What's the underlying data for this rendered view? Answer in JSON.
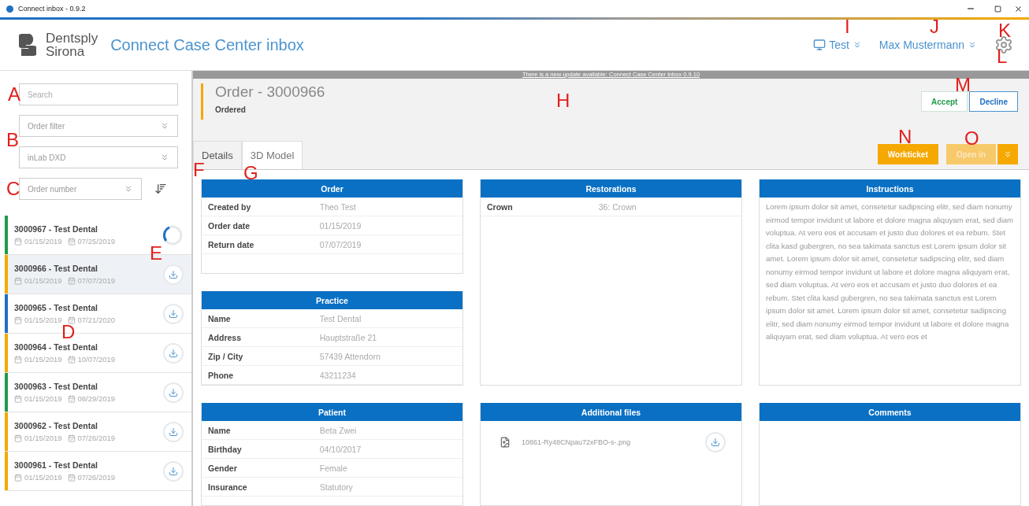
{
  "window": {
    "title": "Connect inbox - 0.9.2"
  },
  "header": {
    "brand_line_1": "Dentsply",
    "brand_line_2": "Sirona",
    "app_title": "Connect Case Center inbox",
    "device": "Test",
    "user": "Max Mustermann"
  },
  "sidebar": {
    "search": {
      "placeholder": "Search"
    },
    "filters": [
      {
        "placeholder": "Order filter"
      },
      {
        "value": "inLab DXD"
      }
    ],
    "sort": {
      "value": "Order number"
    },
    "orders": [
      {
        "title": "3000967 - Test Dental",
        "created": "01/15/2019",
        "due": "07/25/2019",
        "color": "#1e9a4a",
        "selected": false,
        "kind": "loading"
      },
      {
        "title": "3000966 - Test Dental",
        "created": "01/15/2019",
        "due": "07/07/2019",
        "color": "#f5a800",
        "selected": true,
        "kind": "download"
      },
      {
        "title": "3000965 - Test Dental",
        "created": "01/15/2019",
        "due": "07/21/2020",
        "color": "#1f6fc5",
        "selected": false,
        "kind": "download"
      },
      {
        "title": "3000964 - Test Dental",
        "created": "01/15/2019",
        "due": "10/07/2019",
        "color": "#f5a800",
        "selected": false,
        "kind": "download"
      },
      {
        "title": "3000963 - Test Dental",
        "created": "01/15/2019",
        "due": "08/29/2019",
        "color": "#1e9a4a",
        "selected": false,
        "kind": "download"
      },
      {
        "title": "3000962 - Test Dental",
        "created": "01/15/2019",
        "due": "07/26/2019",
        "color": "#f5a800",
        "selected": false,
        "kind": "download"
      },
      {
        "title": "3000961 - Test Dental",
        "created": "01/15/2019",
        "due": "07/26/2019",
        "color": "#f5a800",
        "selected": false,
        "kind": "download"
      }
    ]
  },
  "update_banner": "There is a new update available: Connect Case Center inbox 0.9.10",
  "order": {
    "title": "Order - 3000966",
    "status": "Ordered"
  },
  "tabs": [
    {
      "label": "Details",
      "selected": true
    },
    {
      "label": "3D Model",
      "selected": false
    }
  ],
  "actions": [
    {
      "label": "Accept",
      "kind": "accept"
    },
    {
      "label": "Decline",
      "kind": "decline"
    },
    {
      "label": "Workticket",
      "kind": "primary",
      "disabled": false
    },
    {
      "label": "Open in",
      "kind": "split",
      "disabled": true
    }
  ],
  "panel_columns": [
    [
      {
        "title": "Order",
        "kind": "fields",
        "rows": [
          {
            "label": "Created by",
            "value": "Theo Test"
          },
          {
            "label": "Order date",
            "value": "01/15/2019"
          },
          {
            "label": "Return date",
            "value": "07/07/2019"
          }
        ]
      },
      {
        "title": "Practice",
        "kind": "fields",
        "rows": [
          {
            "label": "Name",
            "value": "Test Dental"
          },
          {
            "label": "Address",
            "value": "Hauptstraße 21"
          },
          {
            "label": "Zip / City",
            "value": "57439 Attendorn"
          },
          {
            "label": "Phone",
            "value": "43211234"
          }
        ]
      },
      {
        "title": "Patient",
        "kind": "fields",
        "rows": [
          {
            "label": "Name",
            "value": "Beta Zwei"
          },
          {
            "label": "Birthday",
            "value": "04/10/2017"
          },
          {
            "label": "Gender",
            "value": "Female"
          },
          {
            "label": "Insurance",
            "value": "Statutory"
          }
        ]
      }
    ],
    [
      {
        "title": "Restorations",
        "kind": "fields",
        "rows": [
          {
            "label": "Crown",
            "value": "36: Crown"
          }
        ]
      },
      {
        "title": "Additional files",
        "kind": "files",
        "files": [
          "10861-Ry48CNpau72xFBO-s-.png"
        ]
      }
    ],
    [
      {
        "title": "Instructions",
        "kind": "text",
        "text": "Lorem ipsum dolor sit amet, consetetur sadipscing elitr, sed diam nonumy eirmod tempor invidunt ut labore et dolore magna aliquyam erat, sed diam voluptua. At vero eos et accusam et justo duo dolores et ea rebum. Stet clita kasd gubergren, no sea takimata sanctus est Lorem ipsum dolor sit amet. Lorem ipsum dolor sit amet, consetetur sadipscing elitr, sed diam nonumy eirmod tempor invidunt ut labore et dolore magna aliquyam erat, sed diam voluptua. At vero eos et accusam et justo duo dolores et ea rebum. Stet clita kasd gubergren, no sea takimata sanctus est Lorem ipsum dolor sit amet. Lorem ipsum dolor sit amet, consetetur sadipscing elitr, sed diam nonumy eirmod tempor invidunt ut labore et dolore magna aliquyam erat, sed diam voluptua. At vero eos et"
      },
      {
        "title": "Comments",
        "kind": "text"
      }
    ]
  ],
  "annotations": [
    {
      "letter": "A"
    },
    {
      "letter": "B"
    },
    {
      "letter": "C"
    },
    {
      "letter": "D"
    },
    {
      "letter": "E"
    },
    {
      "letter": "F"
    },
    {
      "letter": "G"
    },
    {
      "letter": "H"
    },
    {
      "letter": "I"
    },
    {
      "letter": "J"
    },
    {
      "letter": "K"
    },
    {
      "letter": "L"
    },
    {
      "letter": "M"
    },
    {
      "letter": "N"
    },
    {
      "letter": "O"
    }
  ]
}
